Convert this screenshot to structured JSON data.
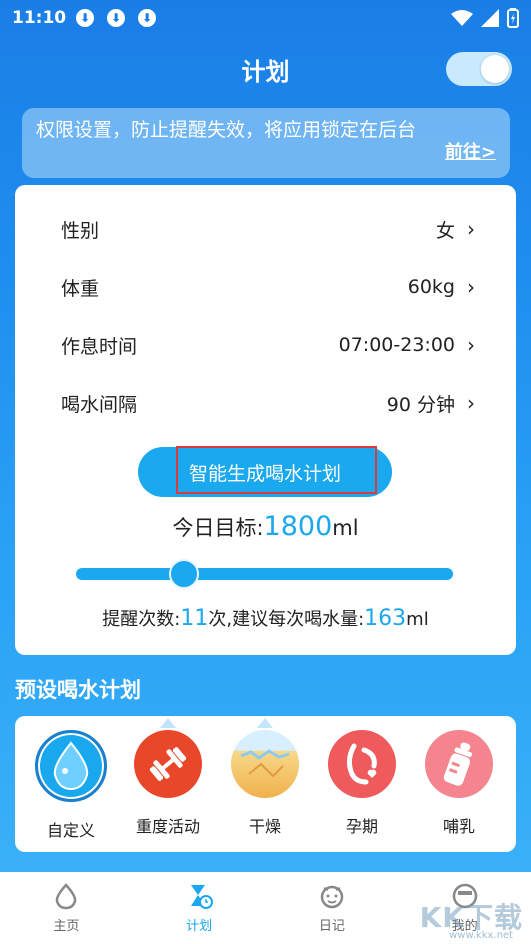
{
  "status_bar": {
    "time": "11:10",
    "download_icon_glyph": "⬇"
  },
  "header": {
    "title": "计划",
    "toggle_on": true
  },
  "notice": {
    "text": "权限设置，防止提醒失效，将应用锁定在后台",
    "link": "前往>"
  },
  "settings": {
    "rows": [
      {
        "label": "性别",
        "value": "女"
      },
      {
        "label": "体重",
        "value": "60kg"
      },
      {
        "label": "作息时间",
        "value": "07:00-23:00"
      },
      {
        "label": "喝水间隔",
        "value": "90 分钟"
      }
    ],
    "chevron": "›",
    "generate_button": "智能生成喝水计划",
    "target_label": "今日目标:",
    "target_value": "1800",
    "target_unit": "ml",
    "slider_fraction": 0.18,
    "remind_label": "提醒次数:",
    "remind_count": "11",
    "remind_mid": "次,建议每次喝水量:",
    "per_drink": "163",
    "per_drink_unit": "ml"
  },
  "presets": {
    "section_title": "预设喝水计划",
    "items": [
      {
        "label": "自定义",
        "icon": "water-drop-icon",
        "color": "#19a7ee"
      },
      {
        "label": "重度活动",
        "icon": "dumbbell-icon",
        "color": "#e8472a"
      },
      {
        "label": "干燥",
        "icon": "dry-glass-icon",
        "color": "#f4c26a"
      },
      {
        "label": "孕期",
        "icon": "pregnancy-icon",
        "color": "#ef5a5d"
      },
      {
        "label": "哺乳",
        "icon": "baby-bottle-icon",
        "color": "#f4858f"
      }
    ]
  },
  "tabbar": {
    "items": [
      {
        "label": "主页",
        "icon": "home-drop-icon"
      },
      {
        "label": "计划",
        "icon": "plan-hourglass-icon"
      },
      {
        "label": "日记",
        "icon": "diary-face-icon"
      },
      {
        "label": "我的",
        "icon": "profile-icon"
      }
    ],
    "active_index": 1
  },
  "watermark": {
    "text": "KK下载",
    "url": "www.kkx.net"
  },
  "colors": {
    "accent": "#1aa8ef",
    "outline_red": "#d93a3a"
  }
}
